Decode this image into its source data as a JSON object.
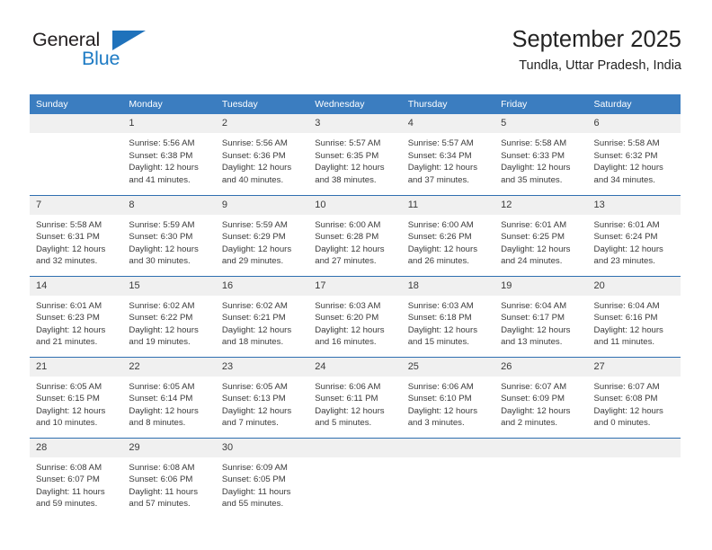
{
  "logo": {
    "primary_text": "General",
    "secondary_text": "Blue",
    "triangle_color": "#1f72bb",
    "secondary_color": "#1e7bc4"
  },
  "header": {
    "title": "September 2025",
    "subtitle": "Tundla, Uttar Pradesh, India"
  },
  "theme": {
    "header_row_bg": "#3b7dc0",
    "header_row_text": "#ffffff",
    "daynum_bg": "#f0f0f0",
    "row_divider": "#2f6fb0",
    "body_text": "#3a3a3a"
  },
  "weekday_headers": [
    "Sunday",
    "Monday",
    "Tuesday",
    "Wednesday",
    "Thursday",
    "Friday",
    "Saturday"
  ],
  "weeks": [
    [
      {
        "day": "",
        "sunrise": "",
        "sunset": "",
        "daylight_line1": "",
        "daylight_line2": ""
      },
      {
        "day": "1",
        "sunrise": "Sunrise: 5:56 AM",
        "sunset": "Sunset: 6:38 PM",
        "daylight_line1": "Daylight: 12 hours",
        "daylight_line2": "and 41 minutes."
      },
      {
        "day": "2",
        "sunrise": "Sunrise: 5:56 AM",
        "sunset": "Sunset: 6:36 PM",
        "daylight_line1": "Daylight: 12 hours",
        "daylight_line2": "and 40 minutes."
      },
      {
        "day": "3",
        "sunrise": "Sunrise: 5:57 AM",
        "sunset": "Sunset: 6:35 PM",
        "daylight_line1": "Daylight: 12 hours",
        "daylight_line2": "and 38 minutes."
      },
      {
        "day": "4",
        "sunrise": "Sunrise: 5:57 AM",
        "sunset": "Sunset: 6:34 PM",
        "daylight_line1": "Daylight: 12 hours",
        "daylight_line2": "and 37 minutes."
      },
      {
        "day": "5",
        "sunrise": "Sunrise: 5:58 AM",
        "sunset": "Sunset: 6:33 PM",
        "daylight_line1": "Daylight: 12 hours",
        "daylight_line2": "and 35 minutes."
      },
      {
        "day": "6",
        "sunrise": "Sunrise: 5:58 AM",
        "sunset": "Sunset: 6:32 PM",
        "daylight_line1": "Daylight: 12 hours",
        "daylight_line2": "and 34 minutes."
      }
    ],
    [
      {
        "day": "7",
        "sunrise": "Sunrise: 5:58 AM",
        "sunset": "Sunset: 6:31 PM",
        "daylight_line1": "Daylight: 12 hours",
        "daylight_line2": "and 32 minutes."
      },
      {
        "day": "8",
        "sunrise": "Sunrise: 5:59 AM",
        "sunset": "Sunset: 6:30 PM",
        "daylight_line1": "Daylight: 12 hours",
        "daylight_line2": "and 30 minutes."
      },
      {
        "day": "9",
        "sunrise": "Sunrise: 5:59 AM",
        "sunset": "Sunset: 6:29 PM",
        "daylight_line1": "Daylight: 12 hours",
        "daylight_line2": "and 29 minutes."
      },
      {
        "day": "10",
        "sunrise": "Sunrise: 6:00 AM",
        "sunset": "Sunset: 6:28 PM",
        "daylight_line1": "Daylight: 12 hours",
        "daylight_line2": "and 27 minutes."
      },
      {
        "day": "11",
        "sunrise": "Sunrise: 6:00 AM",
        "sunset": "Sunset: 6:26 PM",
        "daylight_line1": "Daylight: 12 hours",
        "daylight_line2": "and 26 minutes."
      },
      {
        "day": "12",
        "sunrise": "Sunrise: 6:01 AM",
        "sunset": "Sunset: 6:25 PM",
        "daylight_line1": "Daylight: 12 hours",
        "daylight_line2": "and 24 minutes."
      },
      {
        "day": "13",
        "sunrise": "Sunrise: 6:01 AM",
        "sunset": "Sunset: 6:24 PM",
        "daylight_line1": "Daylight: 12 hours",
        "daylight_line2": "and 23 minutes."
      }
    ],
    [
      {
        "day": "14",
        "sunrise": "Sunrise: 6:01 AM",
        "sunset": "Sunset: 6:23 PM",
        "daylight_line1": "Daylight: 12 hours",
        "daylight_line2": "and 21 minutes."
      },
      {
        "day": "15",
        "sunrise": "Sunrise: 6:02 AM",
        "sunset": "Sunset: 6:22 PM",
        "daylight_line1": "Daylight: 12 hours",
        "daylight_line2": "and 19 minutes."
      },
      {
        "day": "16",
        "sunrise": "Sunrise: 6:02 AM",
        "sunset": "Sunset: 6:21 PM",
        "daylight_line1": "Daylight: 12 hours",
        "daylight_line2": "and 18 minutes."
      },
      {
        "day": "17",
        "sunrise": "Sunrise: 6:03 AM",
        "sunset": "Sunset: 6:20 PM",
        "daylight_line1": "Daylight: 12 hours",
        "daylight_line2": "and 16 minutes."
      },
      {
        "day": "18",
        "sunrise": "Sunrise: 6:03 AM",
        "sunset": "Sunset: 6:18 PM",
        "daylight_line1": "Daylight: 12 hours",
        "daylight_line2": "and 15 minutes."
      },
      {
        "day": "19",
        "sunrise": "Sunrise: 6:04 AM",
        "sunset": "Sunset: 6:17 PM",
        "daylight_line1": "Daylight: 12 hours",
        "daylight_line2": "and 13 minutes."
      },
      {
        "day": "20",
        "sunrise": "Sunrise: 6:04 AM",
        "sunset": "Sunset: 6:16 PM",
        "daylight_line1": "Daylight: 12 hours",
        "daylight_line2": "and 11 minutes."
      }
    ],
    [
      {
        "day": "21",
        "sunrise": "Sunrise: 6:05 AM",
        "sunset": "Sunset: 6:15 PM",
        "daylight_line1": "Daylight: 12 hours",
        "daylight_line2": "and 10 minutes."
      },
      {
        "day": "22",
        "sunrise": "Sunrise: 6:05 AM",
        "sunset": "Sunset: 6:14 PM",
        "daylight_line1": "Daylight: 12 hours",
        "daylight_line2": "and 8 minutes."
      },
      {
        "day": "23",
        "sunrise": "Sunrise: 6:05 AM",
        "sunset": "Sunset: 6:13 PM",
        "daylight_line1": "Daylight: 12 hours",
        "daylight_line2": "and 7 minutes."
      },
      {
        "day": "24",
        "sunrise": "Sunrise: 6:06 AM",
        "sunset": "Sunset: 6:11 PM",
        "daylight_line1": "Daylight: 12 hours",
        "daylight_line2": "and 5 minutes."
      },
      {
        "day": "25",
        "sunrise": "Sunrise: 6:06 AM",
        "sunset": "Sunset: 6:10 PM",
        "daylight_line1": "Daylight: 12 hours",
        "daylight_line2": "and 3 minutes."
      },
      {
        "day": "26",
        "sunrise": "Sunrise: 6:07 AM",
        "sunset": "Sunset: 6:09 PM",
        "daylight_line1": "Daylight: 12 hours",
        "daylight_line2": "and 2 minutes."
      },
      {
        "day": "27",
        "sunrise": "Sunrise: 6:07 AM",
        "sunset": "Sunset: 6:08 PM",
        "daylight_line1": "Daylight: 12 hours",
        "daylight_line2": "and 0 minutes."
      }
    ],
    [
      {
        "day": "28",
        "sunrise": "Sunrise: 6:08 AM",
        "sunset": "Sunset: 6:07 PM",
        "daylight_line1": "Daylight: 11 hours",
        "daylight_line2": "and 59 minutes."
      },
      {
        "day": "29",
        "sunrise": "Sunrise: 6:08 AM",
        "sunset": "Sunset: 6:06 PM",
        "daylight_line1": "Daylight: 11 hours",
        "daylight_line2": "and 57 minutes."
      },
      {
        "day": "30",
        "sunrise": "Sunrise: 6:09 AM",
        "sunset": "Sunset: 6:05 PM",
        "daylight_line1": "Daylight: 11 hours",
        "daylight_line2": "and 55 minutes."
      },
      {
        "day": "",
        "sunrise": "",
        "sunset": "",
        "daylight_line1": "",
        "daylight_line2": ""
      },
      {
        "day": "",
        "sunrise": "",
        "sunset": "",
        "daylight_line1": "",
        "daylight_line2": ""
      },
      {
        "day": "",
        "sunrise": "",
        "sunset": "",
        "daylight_line1": "",
        "daylight_line2": ""
      },
      {
        "day": "",
        "sunrise": "",
        "sunset": "",
        "daylight_line1": "",
        "daylight_line2": ""
      }
    ]
  ]
}
